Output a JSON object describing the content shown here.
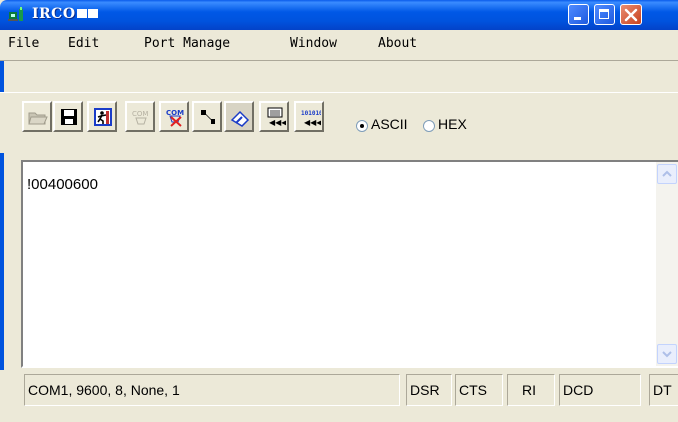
{
  "window": {
    "title": "IRCO",
    "icon": "app-icon"
  },
  "menu": {
    "items": [
      "File",
      "Edit",
      "Port Manage",
      "Window",
      "About"
    ]
  },
  "toolbar": {
    "buttons": [
      {
        "icon": "open-folder-icon",
        "enabled": false
      },
      {
        "icon": "save-disk-icon",
        "enabled": true
      },
      {
        "icon": "run-icon",
        "enabled": true
      },
      {
        "icon": "com-open-icon",
        "enabled": false
      },
      {
        "icon": "com-close-icon",
        "enabled": true
      },
      {
        "icon": "wrench-settings-icon",
        "enabled": true
      },
      {
        "icon": "clear-eraser-icon",
        "enabled": true
      },
      {
        "icon": "display-receive-icon",
        "enabled": true
      },
      {
        "icon": "binary-receive-icon",
        "enabled": true
      }
    ],
    "mode": {
      "ascii_label": "ASCII",
      "hex_label": "HEX",
      "selected": "ASCII"
    }
  },
  "receive": {
    "text": "!00400600"
  },
  "status": {
    "port_info": "COM1, 9600, 8, None, 1",
    "signals": [
      "DSR",
      "CTS",
      "RI",
      "DCD",
      "DT"
    ]
  },
  "colors": {
    "titlebar": "#0053DE",
    "face": "#ECE9D8",
    "close_button": "#C8421E"
  }
}
